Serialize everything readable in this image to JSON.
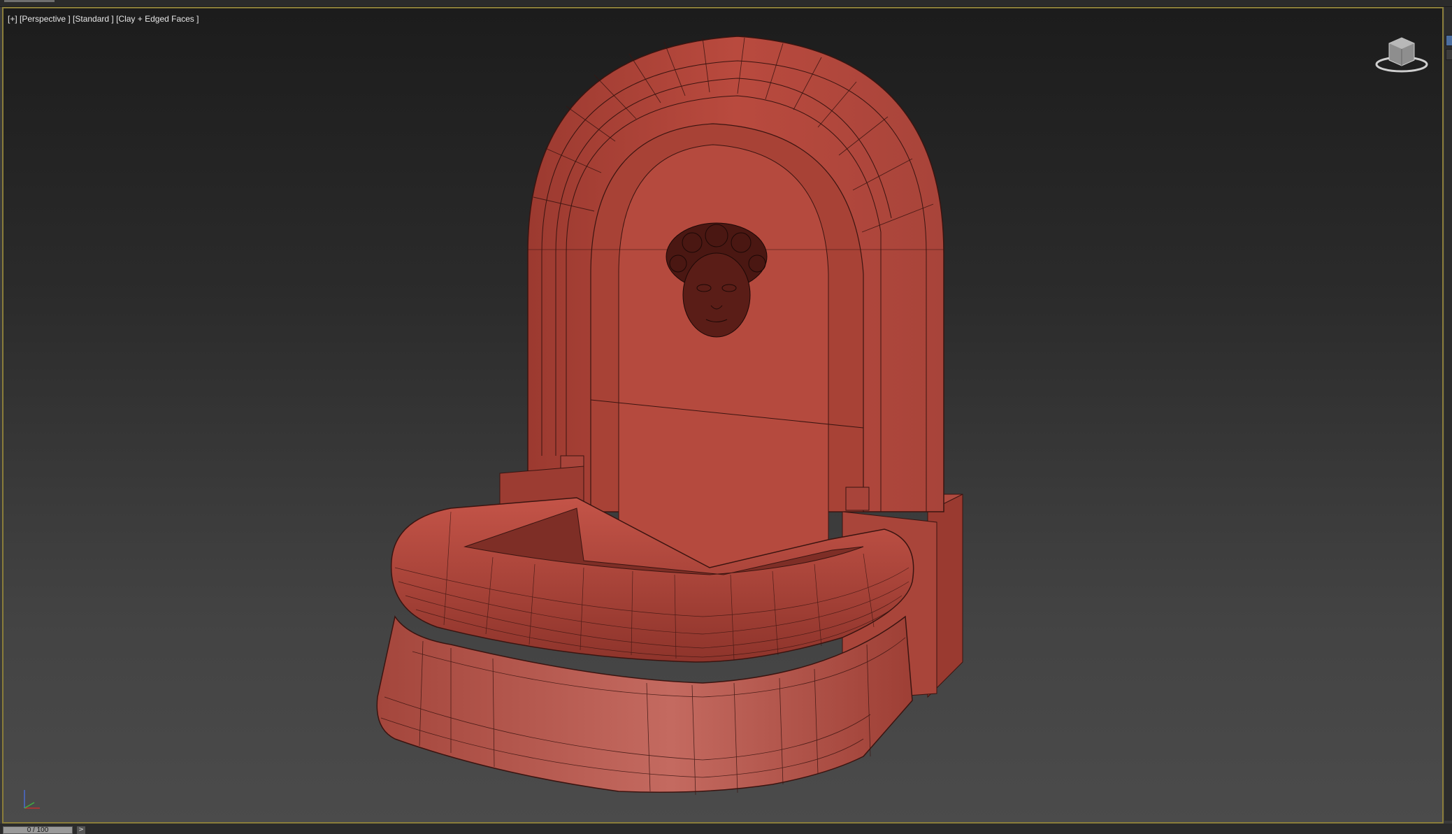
{
  "viewport": {
    "label": "[+] [Perspective ] [Standard ] [Clay + Edged Faces ]",
    "active_border_color": "#8a7d3a",
    "model_color": "#b94a3e"
  },
  "viewcube": {
    "icon": "viewcube-icon"
  },
  "axis_tripod": {
    "icon": "axis-tripod-icon"
  },
  "timeslider": {
    "frame": "0 / 100",
    "next_icon": "chevron-right-icon"
  }
}
